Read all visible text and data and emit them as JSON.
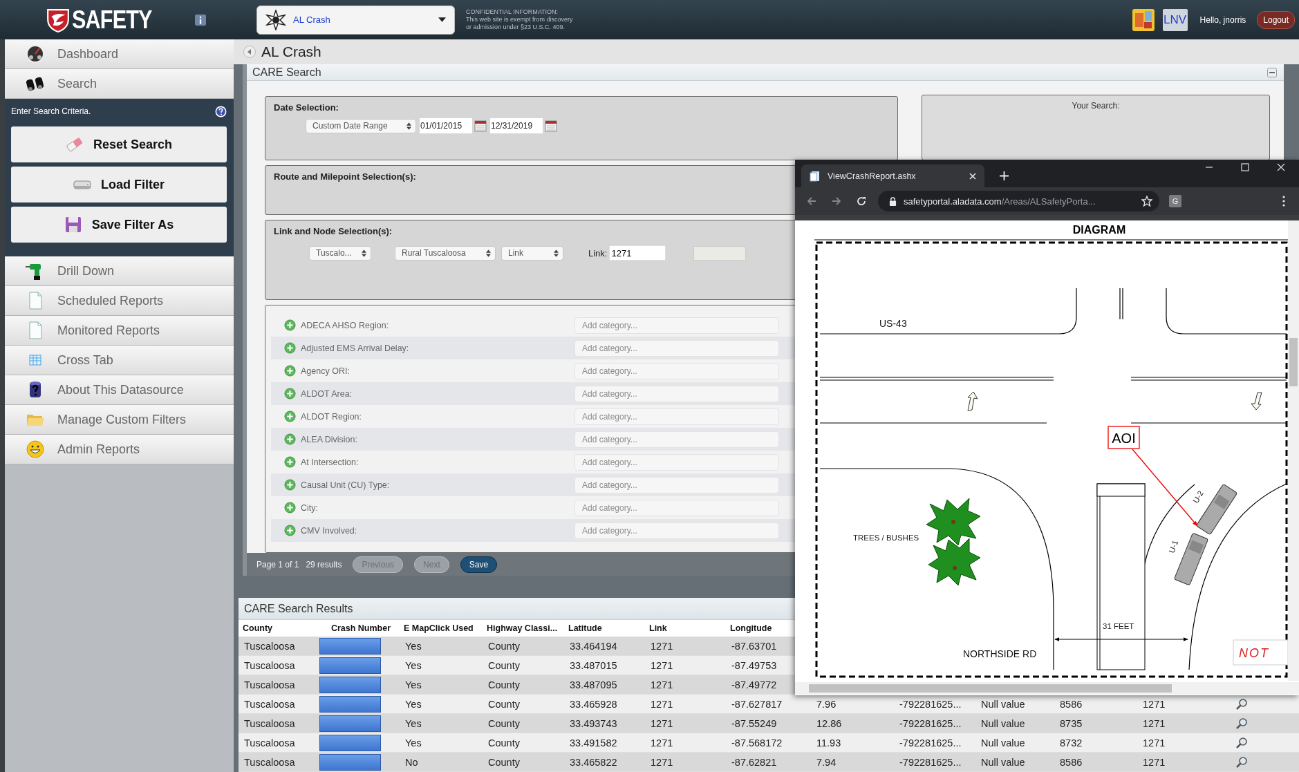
{
  "top_bar": {
    "logo": "SAFETY",
    "datasource": "AL Crash",
    "notice": [
      "CONFIDENTIAL INFORMATION:",
      "This web site is exempt from discovery",
      "or admission under §23 U.S.C. 409."
    ],
    "user_initials": "LNV",
    "greeting": "Hello, jnorris",
    "logout": "Logout"
  },
  "sidebar": {
    "items_top": [
      {
        "label": "Dashboard"
      },
      {
        "label": "Search"
      }
    ],
    "search_panel": {
      "prompt": "Enter Search Criteria.",
      "buttons": [
        {
          "label": "Reset Search"
        },
        {
          "label": "Load Filter"
        },
        {
          "label": "Save Filter As"
        }
      ]
    },
    "items": [
      {
        "label": "Drill Down"
      },
      {
        "label": "Scheduled Reports"
      },
      {
        "label": "Monitored Reports"
      },
      {
        "label": "Cross Tab"
      },
      {
        "label": "About This Datasource"
      },
      {
        "label": "Manage Custom Filters"
      },
      {
        "label": "Admin Reports"
      }
    ]
  },
  "page_title": "AL Crash",
  "care_search": {
    "title": "CARE Search",
    "date_selection": {
      "heading": "Date Selection:",
      "range": "Custom Date Range",
      "start": "01/01/2015",
      "end": "12/31/2019"
    },
    "your_search": {
      "heading": "Your Search:"
    },
    "route": {
      "heading": "Route and Milepoint Selection(s):"
    },
    "link_node": {
      "heading": "Link and Node Selection(s):",
      "county": "Tuscalo...",
      "area": "Rural Tuscaloosa",
      "type": "Link",
      "link_label": "Link:",
      "link_value": "1271"
    },
    "categories": [
      {
        "label": "ADECA AHSO Region:",
        "placeholder": "Add category..."
      },
      {
        "label": "Adjusted EMS Arrival Delay:",
        "placeholder": "Add category..."
      },
      {
        "label": "Agency ORI:",
        "placeholder": "Add category..."
      },
      {
        "label": "ALDOT Area:",
        "placeholder": "Add category..."
      },
      {
        "label": "ALDOT Region:",
        "placeholder": "Add category..."
      },
      {
        "label": "ALEA Division:",
        "placeholder": "Add category..."
      },
      {
        "label": "At Intersection:",
        "placeholder": "Add category..."
      },
      {
        "label": "Causal Unit (CU) Type:",
        "placeholder": "Add category..."
      },
      {
        "label": "City:",
        "placeholder": "Add category..."
      },
      {
        "label": "CMV Involved:",
        "placeholder": "Add category..."
      }
    ],
    "pager": {
      "page": "Page 1 of 1",
      "count": "29 results",
      "buttons": [
        {
          "label": "Previous",
          "disabled": true
        },
        {
          "label": "Next",
          "disabled": true
        },
        {
          "label": "Save",
          "disabled": false
        }
      ]
    }
  },
  "results": {
    "title": "CARE Search Results",
    "columns": [
      "County",
      "Crash Number",
      "E MapClick Used",
      "Highway Classi...",
      "Latitude",
      "Link",
      "Longitude"
    ],
    "rows": [
      {
        "county": "Tuscaloosa",
        "redacted": true,
        "e_mapclick_used": "Yes",
        "highway_class": "County",
        "latitude": "33.464194",
        "link": "1271",
        "longitude": "-87.63701"
      },
      {
        "county": "Tuscaloosa",
        "redacted": true,
        "e_mapclick_used": "Yes",
        "highway_class": "County",
        "latitude": "33.487015",
        "link": "1271",
        "longitude": "-87.49753"
      },
      {
        "county": "Tuscaloosa",
        "redacted": true,
        "e_mapclick_used": "Yes",
        "highway_class": "County",
        "latitude": "33.487095",
        "link": "1271",
        "longitude": "-87.49772"
      },
      {
        "county": "Tuscaloosa",
        "redacted": true,
        "e_mapclick_used": "Yes",
        "highway_class": "County",
        "latitude": "33.465928",
        "link": "1271",
        "longitude": "-87.627817",
        "column_8": "7.96",
        "column_9": "-792281625...",
        "column_10": "Null value",
        "column_11": "8586",
        "column_12": "1271"
      },
      {
        "county": "Tuscaloosa",
        "redacted": true,
        "e_mapclick_used": "Yes",
        "highway_class": "County",
        "latitude": "33.493743",
        "link": "1271",
        "longitude": "-87.55249",
        "column_8": "12.86",
        "column_9": "-792281625...",
        "column_10": "Null value",
        "column_11": "8735",
        "column_12": "1271"
      },
      {
        "county": "Tuscaloosa",
        "redacted": true,
        "e_mapclick_used": "Yes",
        "highway_class": "County",
        "latitude": "33.491582",
        "link": "1271",
        "longitude": "-87.568172",
        "column_8": "11.93",
        "column_9": "-792281625...",
        "column_10": "Null value",
        "column_11": "8732",
        "column_12": "1271"
      },
      {
        "county": "Tuscaloosa",
        "redacted": true,
        "e_mapclick_used": "No",
        "highway_class": "County",
        "latitude": "33.465822",
        "link": "1271",
        "longitude": "-87.62821",
        "column_8": "7.94",
        "column_9": "-792281625...",
        "column_10": "Null value",
        "column_11": "8586",
        "column_12": "1271"
      }
    ]
  },
  "browser": {
    "tab": "ViewCrashReport.ashx",
    "url_host": "safetyportal.aladata.com",
    "url_path": "/Areas/ALSafetyPorta...",
    "extension": "G",
    "diagram": {
      "title": "DIAGRAM",
      "road_top": "US-43",
      "road_bottom": "NORTHSIDE RD",
      "trees": "TREES / BUSHES",
      "dimension": "31 FEET",
      "callout": "AOI",
      "units": [
        "U-2",
        "U-1"
      ],
      "stamp": "NOT"
    }
  }
}
